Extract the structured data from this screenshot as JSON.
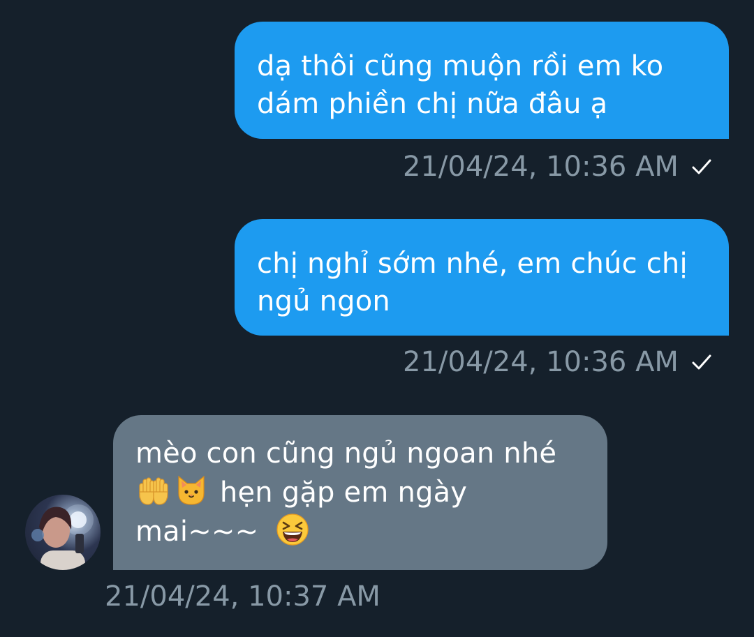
{
  "conversation": {
    "messages": [
      {
        "direction": "sent",
        "lines": [
          "dạ thôi cũng muộn rồi em ko",
          "dám phiền chị nữa đâu ạ"
        ],
        "timestamp": "21/04/24, 10:36 AM",
        "status_icon": "check-icon"
      },
      {
        "direction": "sent",
        "lines": [
          "chị nghỉ sớm nhé, em chúc chị",
          "ngủ ngon"
        ],
        "timestamp": "21/04/24, 10:36 AM",
        "status_icon": "check-icon"
      },
      {
        "direction": "received",
        "lines": [
          "mèo con cũng ngủ ngoan nhé",
          "hẹn gặp em ngày",
          "mai~~~"
        ],
        "emojis": [
          "raised-palms-emoji",
          "cat-face-emoji",
          "laughing-face-emoji"
        ],
        "timestamp": "21/04/24, 10:37 AM"
      }
    ]
  },
  "colors": {
    "background": "#15202b",
    "sent_bubble": "#1d9bf0",
    "received_bubble": "#657786",
    "timestamp_text": "#8899a6"
  }
}
